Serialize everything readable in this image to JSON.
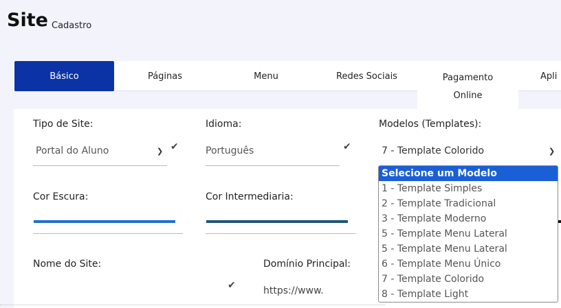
{
  "header": {
    "title": "Site",
    "subtitle": "Cadastro"
  },
  "tabs": [
    {
      "label": "Básico",
      "active": true
    },
    {
      "label": "Páginas"
    },
    {
      "label": "Menu"
    },
    {
      "label": "Redes Sociais"
    },
    {
      "label": "Pagamento Online"
    },
    {
      "label": "Apli"
    }
  ],
  "form": {
    "tipo_site": {
      "label": "Tipo de Site:",
      "value": "Portal do Aluno"
    },
    "idioma": {
      "label": "Idioma:",
      "value": "Português"
    },
    "modelos": {
      "label": "Modelos (Templates):",
      "value": "7 - Template Colorido"
    },
    "cor_escura": {
      "label": "Cor Escura:",
      "color": "#1f6fd1"
    },
    "cor_intermediaria": {
      "label": "Cor Intermediaria:",
      "color": "#1e5578"
    },
    "nome_site": {
      "label": "Nome do Site:"
    },
    "dominio": {
      "label": "Domínio Principal:",
      "value": "https://www."
    }
  },
  "template_options": [
    "Selecione um Modelo",
    "1 - Template Simples",
    "2 - Template Tradicional",
    "3 - Template Moderno",
    "5 - Template Menu Lateral",
    "5 - Template Menu Lateral",
    "6 - Template Menu Único",
    "7 - Template Colorido",
    "8 - Template Light"
  ],
  "colors": {
    "primary": "#0b33a5",
    "highlight": "#1a5fd6"
  }
}
